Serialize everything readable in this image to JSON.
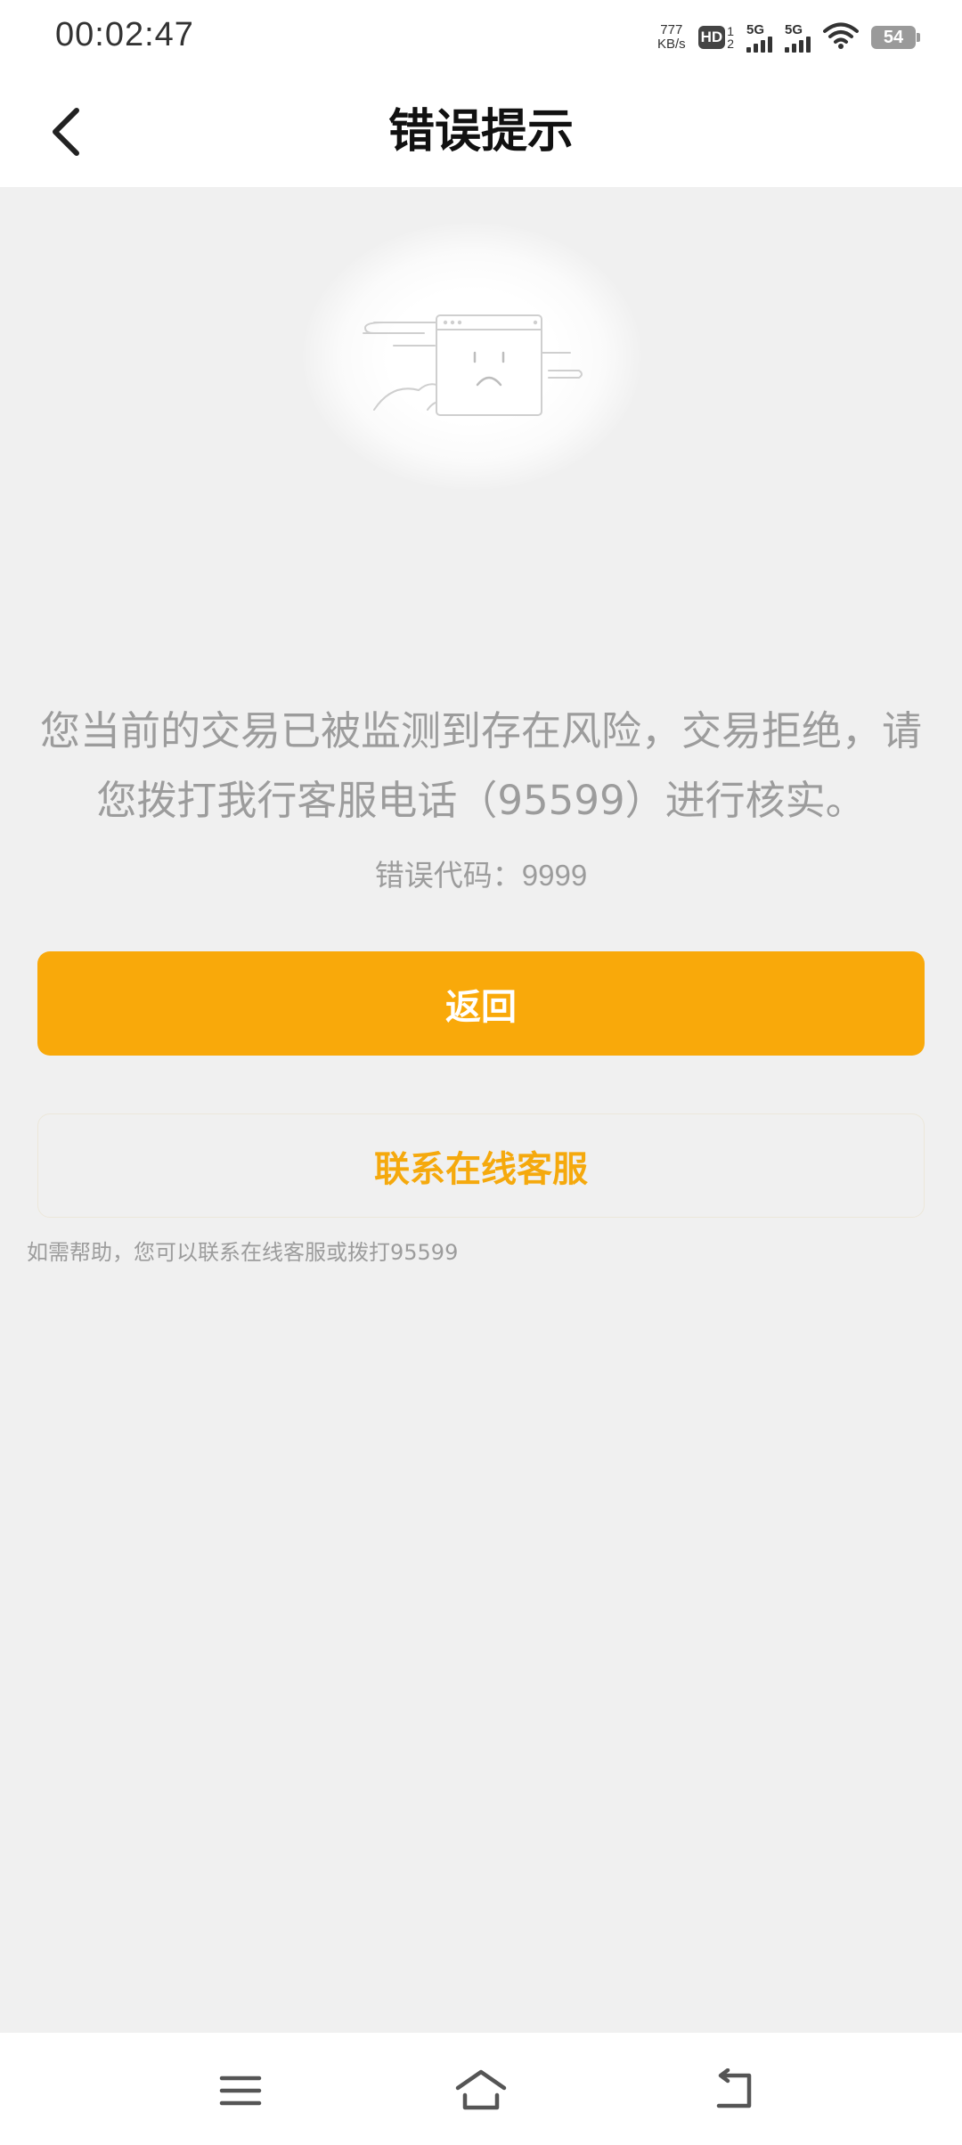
{
  "status_bar": {
    "time": "00:02:47",
    "net_speed_value": "777",
    "net_speed_unit": "KB/s",
    "hd_label": "HD",
    "hd_sub_top": "1",
    "hd_sub_bottom": "2",
    "sim1_label": "5G",
    "sim2_label": "5G",
    "battery_level": "54"
  },
  "header": {
    "title": "错误提示",
    "back_icon": "chevron-left-icon"
  },
  "illustration": {
    "icon": "sad-browser-window-illustration"
  },
  "error": {
    "message": "您当前的交易已被监测到存在风险，交易拒绝，请您拨打我行客服电话（95599）进行核实。",
    "code_label": "错误代码：",
    "code_value": "9999"
  },
  "actions": {
    "return_label": "返回",
    "contact_label": "联系在线客服"
  },
  "help_text": "如需帮助，您可以联系在线客服或拨打95599",
  "colors": {
    "accent": "#f9a90a",
    "text_muted": "#9c9c9c",
    "background": "#f0f0f0"
  },
  "system_nav": {
    "menu_icon": "menu-icon",
    "home_icon": "home-icon",
    "back_icon": "back-arrow-icon"
  }
}
